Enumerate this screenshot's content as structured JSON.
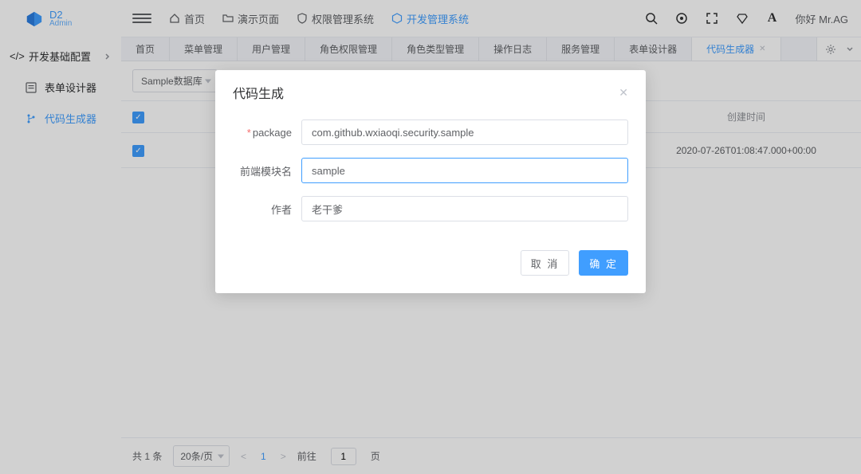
{
  "logo": {
    "line1": "D2",
    "line2": "Admin"
  },
  "sidebar": {
    "group": "开发基础配置",
    "items": [
      {
        "label": "表单设计器"
      },
      {
        "label": "代码生成器"
      }
    ]
  },
  "topmenu": [
    {
      "label": "首页"
    },
    {
      "label": "演示页面"
    },
    {
      "label": "权限管理系统"
    },
    {
      "label": "开发管理系统"
    }
  ],
  "greeting": "你好 Mr.AG",
  "tabs": [
    {
      "label": "首页"
    },
    {
      "label": "菜单管理"
    },
    {
      "label": "用户管理"
    },
    {
      "label": "角色权限管理"
    },
    {
      "label": "角色类型管理"
    },
    {
      "label": "操作日志"
    },
    {
      "label": "服务管理"
    },
    {
      "label": "表单设计器"
    },
    {
      "label": "代码生成器"
    }
  ],
  "toolbar": {
    "chip": "Sample数据库"
  },
  "table": {
    "headers": {
      "time": "创建时间"
    },
    "rows": [
      {
        "time": "2020-07-26T01:08:47.000+00:00"
      }
    ]
  },
  "pager": {
    "total_label": "共 1 条",
    "page_size_label": "20条/页",
    "current": "1",
    "jump_prefix": "前往",
    "jump_value": "1",
    "jump_suffix": "页"
  },
  "modal": {
    "title": "代码生成",
    "fields": {
      "package": {
        "label": "package",
        "value": "com.github.wxiaoqi.security.sample",
        "required": true
      },
      "module": {
        "label": "前端模块名",
        "value": "sample"
      },
      "author": {
        "label": "作者",
        "value": "老干爹"
      }
    },
    "cancel": "取 消",
    "ok": "确 定"
  }
}
